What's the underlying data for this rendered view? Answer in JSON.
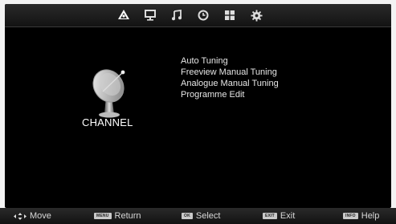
{
  "tabs": [
    {
      "icon": "satellite-dish-icon",
      "active": true
    },
    {
      "icon": "monitor-icon",
      "active": false
    },
    {
      "icon": "music-note-icon",
      "active": false
    },
    {
      "icon": "clock-icon",
      "active": false
    },
    {
      "icon": "lock-grid-icon",
      "active": false
    },
    {
      "icon": "gear-icon",
      "active": false
    }
  ],
  "section": {
    "title": "CHANNEL",
    "icon": "satellite-dish-icon"
  },
  "menu": {
    "items": [
      {
        "label": "Auto Tuning"
      },
      {
        "label": "Freeview Manual Tuning"
      },
      {
        "label": "Analogue Manual Tuning"
      },
      {
        "label": "Programme Edit"
      }
    ]
  },
  "footer": {
    "move": {
      "icon": "arrows-icon",
      "label": "Move"
    },
    "return": {
      "key": "MENU",
      "label": "Return"
    },
    "select": {
      "key": "OK",
      "label": "Select"
    },
    "exit": {
      "key": "EXIT",
      "label": "Exit"
    },
    "help": {
      "key": "INFO",
      "label": "Help"
    }
  },
  "colors": {
    "background": "#000000",
    "text": "#e6e6e6",
    "bar": "#1c1c1c"
  }
}
